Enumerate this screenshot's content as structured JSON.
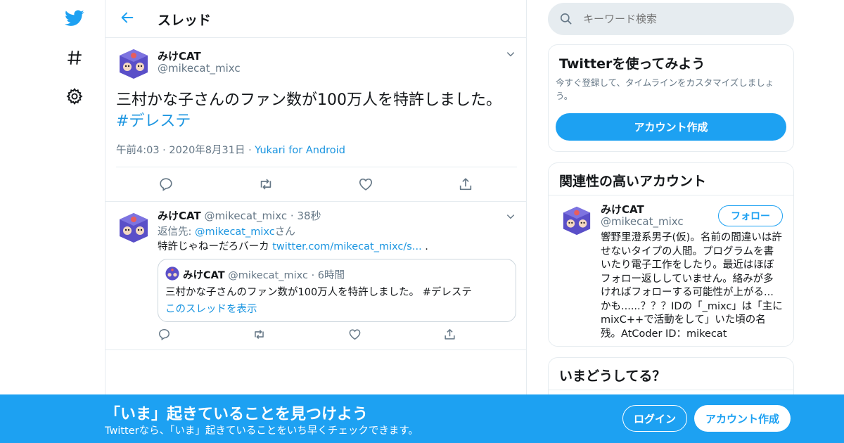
{
  "header": {
    "title": "スレッド"
  },
  "main_tweet": {
    "name": "みけCAT",
    "handle": "@mikecat_mixc",
    "text": "三村かな子さんのファン数が100万人を特許しました。",
    "hashtag": "#デレステ",
    "time": "午前4:03",
    "date": "2020年8月31日",
    "source": "Yukari for Android",
    "separator": "·"
  },
  "reply_tweet": {
    "name": "みけCAT",
    "handle": "@mikecat_mixc",
    "age": "38秒",
    "reply_to_prefix": "返信先:",
    "reply_to_handle": "@mikecat_mixc",
    "reply_to_suffix": "さん",
    "text": "特許じゃねーだろバーカ",
    "link": "twitter.com/mikecat_mixc/s...",
    "trailing": ".",
    "quote": {
      "name": "みけCAT",
      "handle": "@mikecat_mixc",
      "age": "6時間",
      "text": "三村かな子さんのファン数が100万人を特許しました。 #デレステ",
      "show_thread": "このスレッドを表示"
    }
  },
  "search": {
    "placeholder": "キーワード検索"
  },
  "signup_card": {
    "title": "Twitterを使ってみよう",
    "desc": "今すぐ登録して、タイムラインをカスタマイズしましょう。",
    "button": "アカウント作成"
  },
  "related_card": {
    "title": "関連性の高いアカウント",
    "name": "みけCAT",
    "handle": "@mikecat_mixc",
    "follow": "フォロー",
    "bio": "響野里澄系男子(仮)。名前の間違いは許せないタイプの人間。プログラムを書いたり電子工作をしたり。最近はほぼフォロー返ししていません。絡みが多ければフォローする可能性が上がる...かも......？？？IDの「_mixc」は「主にmixC++で活動をして」いた頃の名残。AtCoder ID：mikecat"
  },
  "trends_card": {
    "title": "いまどうしてる？"
  },
  "bottom_bar": {
    "title": "「いま」起きていることを見つけよう",
    "subtitle": "Twitterなら、「いま」起きていることをいち早くチェックできます。",
    "login": "ログイン",
    "signup": "アカウント作成"
  },
  "colors": {
    "accent": "#1da1f2",
    "link": "#1b95e0",
    "muted": "#657786",
    "border": "#e6ecf0"
  },
  "icons": [
    "twitter-bird-icon",
    "hashtag-icon",
    "gear-icon",
    "back-arrow-icon",
    "chevron-down-icon",
    "reply-icon",
    "retweet-icon",
    "like-icon",
    "share-icon",
    "search-icon"
  ]
}
